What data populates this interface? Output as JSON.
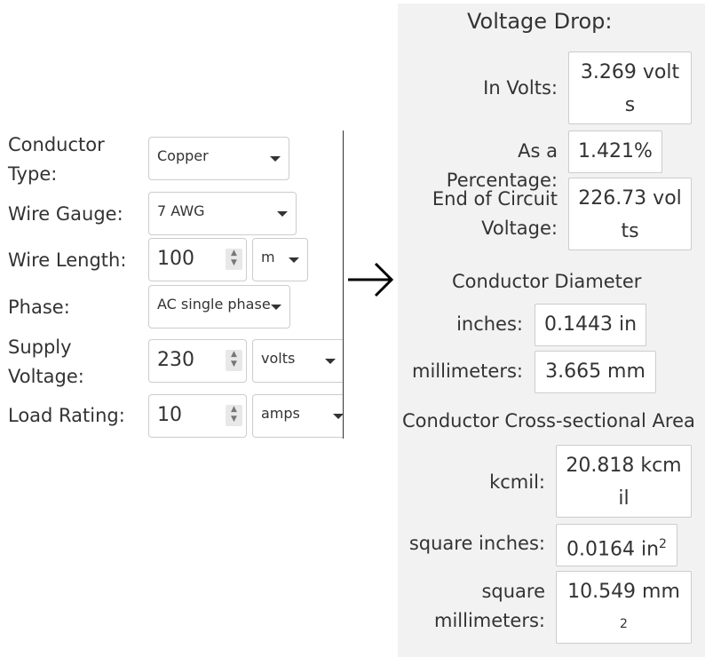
{
  "form": {
    "conductor_type": {
      "label": "Conductor Type:",
      "value": "Copper"
    },
    "wire_gauge": {
      "label": "Wire Gauge:",
      "value": "7 AWG"
    },
    "wire_length": {
      "label": "Wire Length:",
      "value": "100",
      "unit": "m"
    },
    "phase": {
      "label": "Phase:",
      "value": "AC single phase"
    },
    "supply_voltage": {
      "label": "Supply Voltage:",
      "value": "230",
      "unit": "volts"
    },
    "load_rating": {
      "label": "Load Rating:",
      "value": "10",
      "unit": "amps"
    }
  },
  "arrow_glyph": "→",
  "results": {
    "voltage_drop": {
      "heading": "Voltage Drop:",
      "in_volts_label": "In Volts:",
      "in_volts_value": "3.269 volts",
      "percentage_label": "As a Percentage:",
      "percentage_value": "1.421%",
      "end_voltage_label": "End of Circuit Voltage:",
      "end_voltage_value": "226.73 volts"
    },
    "diameter": {
      "heading": "Conductor Diameter",
      "inches_label": "inches:",
      "inches_value": "0.1443 in",
      "mm_label": "millimeters:",
      "mm_value": "3.665 mm"
    },
    "area": {
      "heading": "Conductor Cross-sectional Area",
      "kcmil_label": "kcmil:",
      "kcmil_value": "20.818 kcmil",
      "sq_in_label": "square inches:",
      "sq_in_value": "0.0164 in",
      "sq_in_sup": "2",
      "sq_mm_label": "square millimeters:",
      "sq_mm_value": "10.549 mm",
      "sq_mm_sup": "2"
    }
  }
}
